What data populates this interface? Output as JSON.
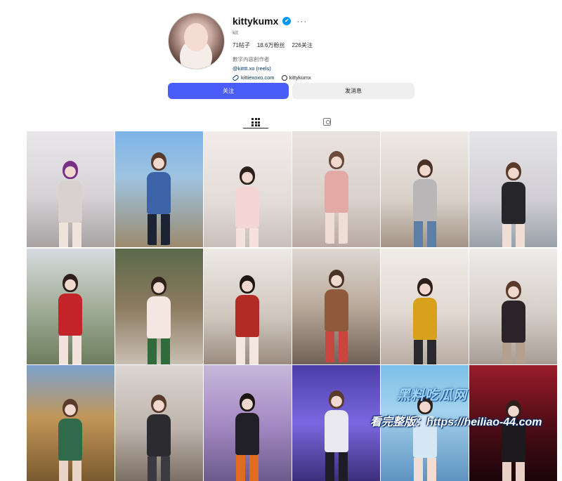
{
  "profile": {
    "username": "kittykumx",
    "more_label": "···",
    "subname": "kit",
    "stats": {
      "posts": "71帖子",
      "followers": "18.6万粉丝",
      "following": "226关注"
    },
    "category": "數字內容創作者",
    "mention_link": "@kitttt.xo (reels)",
    "website": "kittiexoxo.com",
    "threads_handle": "kittykumx"
  },
  "actions": {
    "follow_label": "关注",
    "message_label": "发消息"
  },
  "tabs": [
    {
      "name": "posts",
      "icon": "grid-icon",
      "active": true
    },
    {
      "name": "tagged",
      "icon": "tagged-icon",
      "active": false
    }
  ],
  "colors": {
    "follow_button": "#4a5df9",
    "verified": "#0095f6",
    "link": "#00376b"
  },
  "posts": [
    {
      "bg": "linear-gradient(180deg,#e9e7e9 0%,#d7d3d6 55%,#a8a2a3 100%)",
      "hair": "#7a2f86",
      "body": "#d8d1cf",
      "legs": "#efe3dc"
    },
    {
      "bg": "linear-gradient(180deg,#7eb4e8 0%,#9ec3e0 40%,#9b8a6d 100%)",
      "hair": "#5a3a2c",
      "body": "#3c63a8",
      "legs": "#1c2333"
    },
    {
      "bg": "linear-gradient(180deg,#f1ecea 0%,#e3ddd9 60%,#c9bfba 100%)",
      "hair": "#2b201c",
      "body": "#f3d5d4",
      "legs": "#f6e2dd"
    },
    {
      "bg": "linear-gradient(180deg,#e9e3df 0%,#d9d0cb 60%,#b8aaa2 100%)",
      "hair": "#6b4a39",
      "body": "#e3a9a4",
      "legs": "#f0ddd6"
    },
    {
      "bg": "linear-gradient(180deg,#eeeae6 0%,#d8cfc7 60%,#a39487 100%)",
      "hair": "#4a3227",
      "body": "#b9b6b8",
      "legs": "#5d7fa6"
    },
    {
      "bg": "linear-gradient(180deg,#e6e5e9 0%,#cfcdd3 60%,#9aa1a9 100%)",
      "hair": "#5a3b2b",
      "body": "#26252a",
      "legs": "#f0ddd3"
    },
    {
      "bg": "linear-gradient(180deg,#d6dbdf 0%,#a7b3a0 45%,#6e7d5d 100%)",
      "hair": "#2e1f1a",
      "body": "#c3242a",
      "legs": "#f2e3de"
    },
    {
      "bg": "linear-gradient(180deg,#5b6a4b 0%,#8b7a5f 50%,#c9bfb3 100%)",
      "hair": "#2e1f1a",
      "body": "#f4e7e2",
      "legs": "#2f6b3b"
    },
    {
      "bg": "linear-gradient(180deg,#eeeae6 0%,#cfc5bd 60%,#9a8c80 100%)",
      "hair": "#1b1614",
      "body": "#b12a23",
      "legs": "#f3e5df"
    },
    {
      "bg": "linear-gradient(180deg,#ded8d3 0%,#b9a99b 50%,#6f6157 100%)",
      "hair": "#4a3227",
      "body": "#8e5a3a",
      "legs": "#c9453f"
    },
    {
      "bg": "linear-gradient(180deg,#f0ece8 0%,#e2d9d2 55%,#b9aca2 100%)",
      "hair": "#2e1f1a",
      "body": "#d8a11c",
      "legs": "#2a2a2e"
    },
    {
      "bg": "linear-gradient(180deg,#eeebea 0%,#d6cfc9 55%,#a89d95 100%)",
      "hair": "#5a3b2b",
      "body": "#2a2428",
      "legs": "#b3a08f"
    },
    {
      "bg": "linear-gradient(180deg,#7ca3cf 0%,#c29659 45%,#7a5a2f 100%)",
      "hair": "#5a3b2b",
      "body": "#2f6b4a",
      "legs": "#e9d6c8"
    },
    {
      "bg": "linear-gradient(180deg,#dcd7d3 0%,#bdb3aa 55%,#7c6f65 100%)",
      "hair": "#5a3b2b",
      "body": "#2b2b30",
      "legs": "#3b3a40"
    },
    {
      "bg": "linear-gradient(180deg,#c7b7d9 0%,#a58bc4 50%,#6d5a8c 100%)",
      "hair": "#1b1614",
      "body": "#202026",
      "legs": "#e06d1f"
    },
    {
      "bg": "linear-gradient(180deg,#4b3ea8 0%,#7b67e0 50%,#3b2f7a 100%)",
      "hair": "#5a3b2b",
      "body": "#eae8ef",
      "legs": "#1e1d25"
    },
    {
      "bg": "linear-gradient(180deg,#7cc0e8 0%,#a3d2ee 40%,#5f93bf 100%)",
      "hair": "#2e1f1a",
      "body": "#d5e7f4",
      "legs": "#f0ddd6"
    },
    {
      "bg": "linear-gradient(180deg,#9a1c2a 0%,#4a0c15 55%,#1a0509 100%)",
      "hair": "#2e1f1a",
      "body": "#1c1a1c",
      "legs": "#e9d0c6"
    }
  ],
  "watermark": {
    "line1": "黑料吃瓜网",
    "line2": "看完整版：https://heiliao-44.com"
  }
}
